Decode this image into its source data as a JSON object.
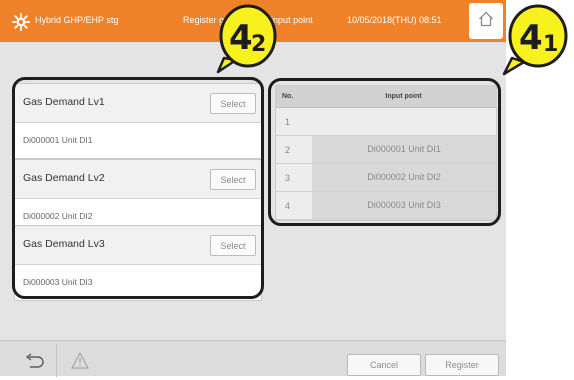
{
  "header": {
    "app_title": "Hybrid GHP/EHP stg",
    "screen_title": "Register gas demand input point",
    "datetime": "10/05/2018(THU) 08:51",
    "home_icon": "home-icon",
    "color": "#ef8229"
  },
  "demand_levels": [
    {
      "name": "Gas Demand Lv1",
      "select_label": "Select",
      "value": "Di000001 Unit DI1"
    },
    {
      "name": "Gas Demand Lv2",
      "select_label": "Select",
      "value": "Di000002 Unit DI2"
    },
    {
      "name": "Gas Demand Lv3",
      "select_label": "Select",
      "value": "Di000003 Unit DI3"
    }
  ],
  "input_table": {
    "headers": {
      "no": "No.",
      "point": "Input point"
    },
    "rows": [
      {
        "no": "1",
        "point": ""
      },
      {
        "no": "2",
        "point": "Di000001 Unit DI1"
      },
      {
        "no": "3",
        "point": "Di000002 Unit DI2"
      },
      {
        "no": "4",
        "point": "Di000003 Unit DI3"
      }
    ]
  },
  "footer": {
    "back_icon": "back-arrow-icon",
    "warning_icon": "warning-icon",
    "cancel_label": "Cancel",
    "register_label": "Register"
  },
  "callouts": {
    "left": {
      "number": "4",
      "sub": "2"
    },
    "right": {
      "number": "4",
      "sub": "1"
    },
    "color": "#f7f21e"
  }
}
